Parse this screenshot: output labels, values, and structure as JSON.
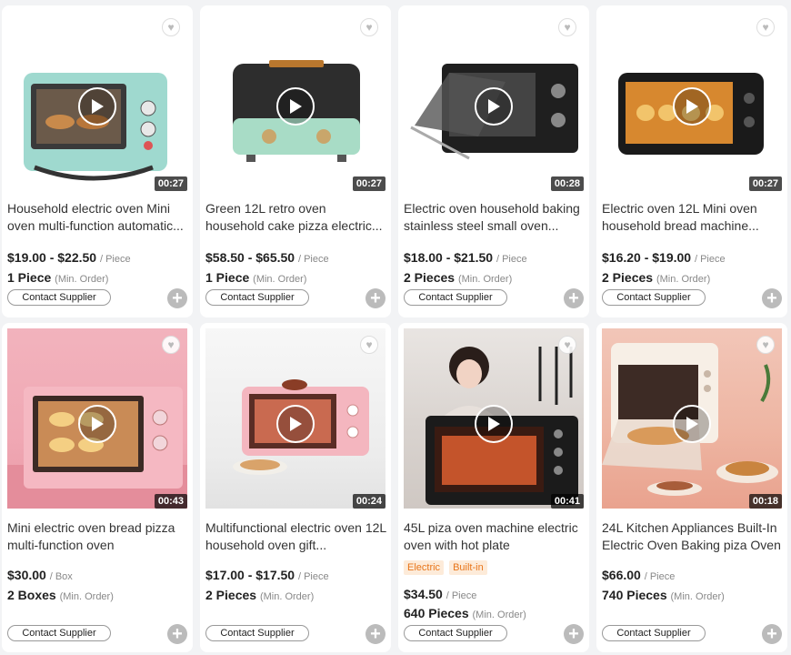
{
  "products": [
    {
      "title": "Household electric oven Mini oven multi-function automatic...",
      "price": "$19.00 - $22.50",
      "unit": "/ Piece",
      "moq": "1 Piece",
      "moq_label": "(Min. Order)",
      "duration": "00:27",
      "contact": "Contact Supplier",
      "tags": []
    },
    {
      "title": "Green 12L retro oven household cake pizza electric...",
      "price": "$58.50 - $65.50",
      "unit": "/ Piece",
      "moq": "1 Piece",
      "moq_label": "(Min. Order)",
      "duration": "00:27",
      "contact": "Contact Supplier",
      "tags": []
    },
    {
      "title": "Electric oven household baking stainless steel small oven...",
      "price": "$18.00 - $21.50",
      "unit": "/ Piece",
      "moq": "2 Pieces",
      "moq_label": "(Min. Order)",
      "duration": "00:28",
      "contact": "Contact Supplier",
      "tags": []
    },
    {
      "title": "Electric oven 12L Mini oven household bread machine...",
      "price": "$16.20 - $19.00",
      "unit": "/ Piece",
      "moq": "2 Pieces",
      "moq_label": "(Min. Order)",
      "duration": "00:27",
      "contact": "Contact Supplier",
      "tags": []
    },
    {
      "title": "Mini electric oven bread pizza multi-function oven",
      "price": "$30.00",
      "unit": "/ Box",
      "moq": "2 Boxes",
      "moq_label": "(Min. Order)",
      "duration": "00:43",
      "contact": "Contact Supplier",
      "tags": []
    },
    {
      "title": "Multifunctional electric oven 12L household oven gift...",
      "price": "$17.00 - $17.50",
      "unit": "/ Piece",
      "moq": "2 Pieces",
      "moq_label": "(Min. Order)",
      "duration": "00:24",
      "contact": "Contact Supplier",
      "tags": []
    },
    {
      "title": "45L piza oven machine electric oven with hot plate",
      "price": "$34.50",
      "unit": "/ Piece",
      "moq": "640 Pieces",
      "moq_label": "(Min. Order)",
      "duration": "00:41",
      "contact": "Contact Supplier",
      "tags": [
        "Electric",
        "Built-in"
      ]
    },
    {
      "title": "24L Kitchen Appliances Built-In Electric Oven Baking piza Oven",
      "price": "$66.00",
      "unit": "/ Piece",
      "moq": "740 Pieces",
      "moq_label": "(Min. Order)",
      "duration": "00:18",
      "contact": "Contact Supplier",
      "tags": []
    }
  ],
  "colors": {
    "tag_text": "#e8751a",
    "tag_bg": "#fdebd9",
    "mint": "#9fd9cf",
    "pink": "#f4b6bf"
  }
}
